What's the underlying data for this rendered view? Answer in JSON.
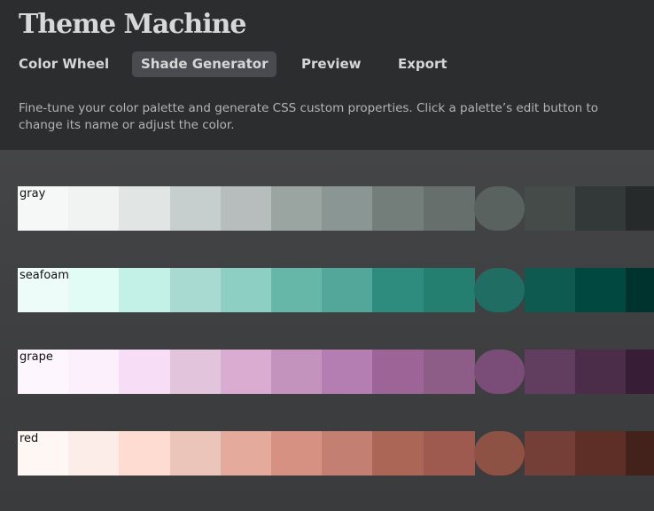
{
  "app": {
    "title": "Theme Machine",
    "description": "Fine-tune your color palette and generate CSS custom properties. Click a palette’s edit button to change its name or adjust the color."
  },
  "tabs": [
    {
      "label": "Color Wheel",
      "active": false
    },
    {
      "label": "Shade Generator",
      "active": true
    },
    {
      "label": "Preview",
      "active": false
    },
    {
      "label": "Export",
      "active": false
    }
  ],
  "palettes": [
    {
      "name": "gray",
      "base_index": 9,
      "colors": [
        "#f6f8f7",
        "#f1f3f2",
        "#e1e5e4",
        "#c7cfce",
        "#b6bdbc",
        "#9aa5a2",
        "#8a9693",
        "#737d7a",
        "#666f6c",
        "#5a6260",
        "#444b49",
        "#333938",
        "#262a2a"
      ]
    },
    {
      "name": "seafoam",
      "base_index": 9,
      "colors": [
        "#eefcf9",
        "#e0fcf4",
        "#c4f1e7",
        "#a8dad1",
        "#8ecfc4",
        "#67b7a8",
        "#52a69a",
        "#2e8c7e",
        "#257f71",
        "#1f6d63",
        "#0e5a50",
        "#004840",
        "#00332d"
      ]
    },
    {
      "name": "grape",
      "base_index": 9,
      "colors": [
        "#fdf6fe",
        "#fcf0fd",
        "#f8ddf6",
        "#e2c4dd",
        "#dbacd1",
        "#c393bd",
        "#b47eb2",
        "#9d6597",
        "#8d5c87",
        "#7a4d79",
        "#613d5f",
        "#4c2d49",
        "#381d36"
      ]
    },
    {
      "name": "red",
      "base_index": 9,
      "colors": [
        "#fef7f4",
        "#fcede8",
        "#fedcd1",
        "#ebc4ba",
        "#e4ab9c",
        "#d69182",
        "#c47f73",
        "#ab6656",
        "#9e5a4e",
        "#8d5244",
        "#733f36",
        "#5d2f27",
        "#43221c"
      ]
    }
  ]
}
